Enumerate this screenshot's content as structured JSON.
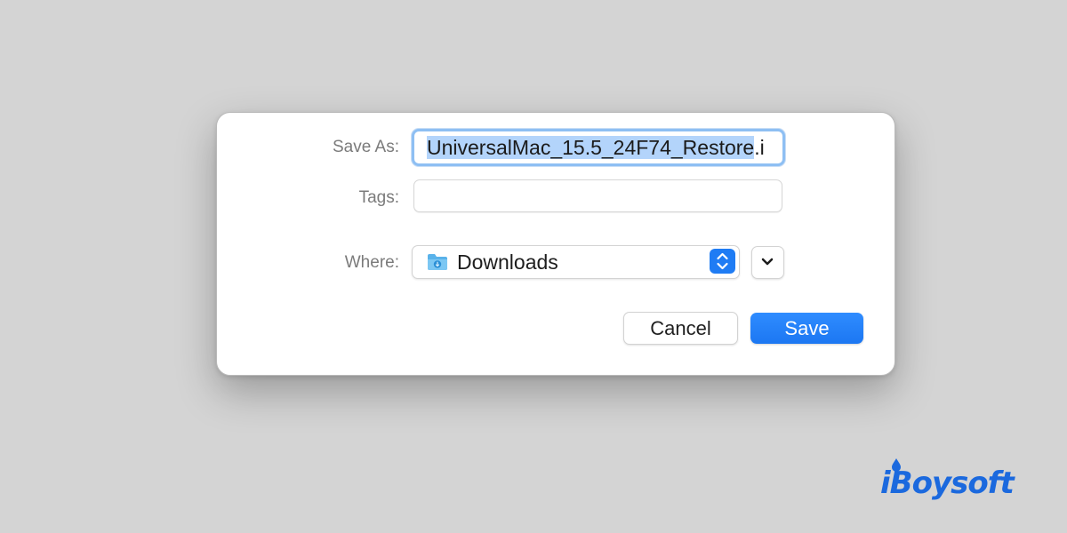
{
  "dialog": {
    "save_as_label": "Save As:",
    "file_name_selected": "UniversalMac_15.5_24F74_Restore",
    "file_name_tail": ".i",
    "tags_label": "Tags:",
    "tags_value": "",
    "where_label": "Where:",
    "where_value": "Downloads",
    "cancel_label": "Cancel",
    "save_label": "Save"
  },
  "icons": {
    "folder": "folder-icon",
    "stepper": "up-down-chevron-icon",
    "expand": "chevron-down-icon"
  },
  "colors": {
    "accent": "#1c77f2",
    "selection": "#b3d4fb",
    "focus_ring": "#8ebff3",
    "brand": "#1b69de"
  },
  "watermark": {
    "text": "iBoysoft"
  }
}
